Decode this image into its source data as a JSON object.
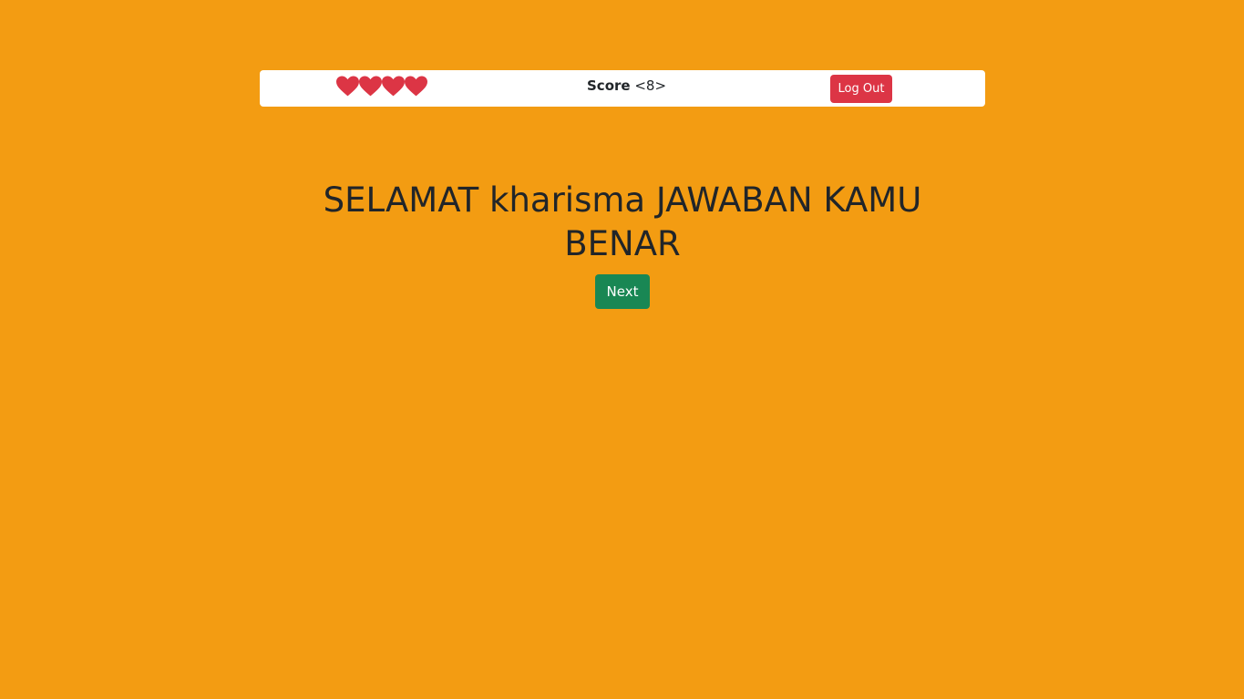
{
  "header": {
    "lives": [
      "heart-icon",
      "heart-icon",
      "heart-icon",
      "heart-icon"
    ],
    "score_label": "Score",
    "score_value": "<8>",
    "logout_label": "Log Out"
  },
  "main": {
    "message": "SELAMAT kharisma JAWABAN KAMU BENAR",
    "next_label": "Next"
  },
  "colors": {
    "background": "#f39c12",
    "heart": "#dc3545",
    "logout_button": "#dc3545",
    "next_button": "#198754"
  }
}
